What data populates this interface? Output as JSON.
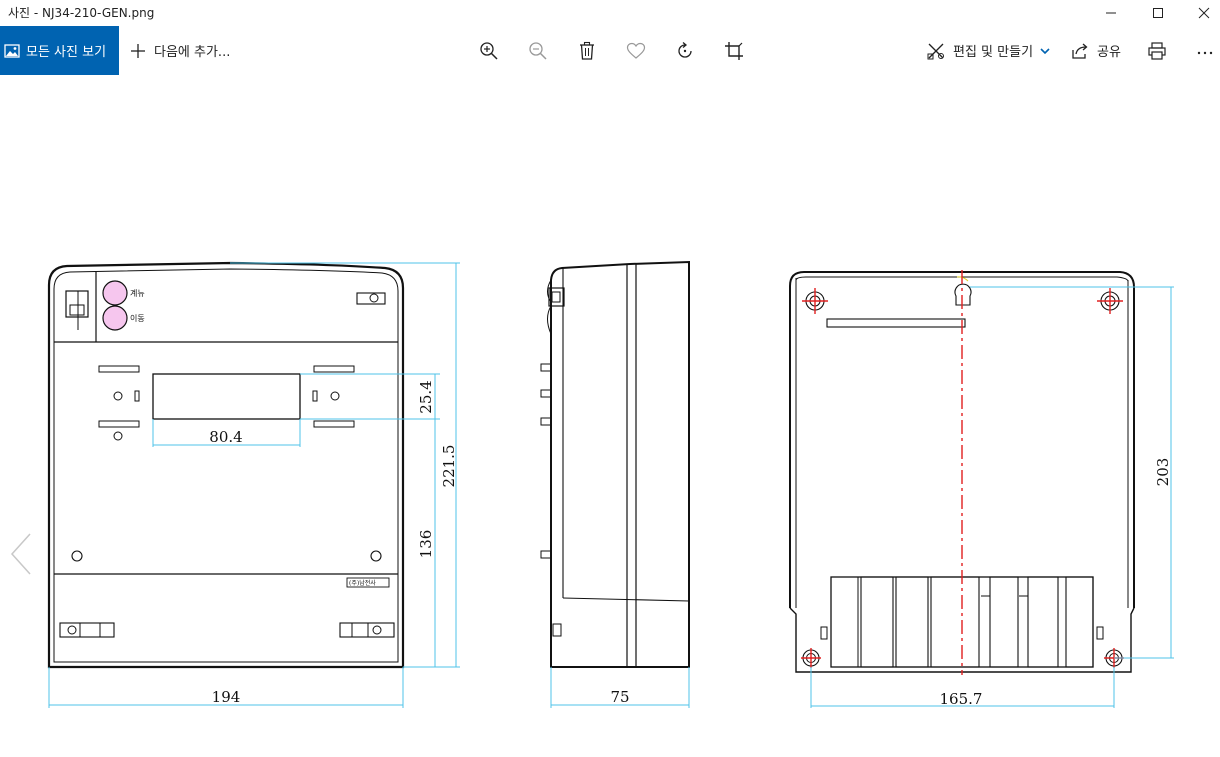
{
  "window": {
    "title": "사진 - NJ34-210-GEN.png"
  },
  "toolbar": {
    "all_photos_label": "모든 사진 보기",
    "add_to_label": "다음에 추가...",
    "edit_create_label": "편집 및 만들기",
    "share_label": "공유"
  },
  "drawing": {
    "front_button_top_label": "계뉴",
    "front_button_bottom_label": "이동",
    "nameplate_label": "(주)남전사",
    "dim_window_width": "80.4",
    "dim_window_height": "25.4",
    "dim_height_total": "221.5",
    "dim_height_lower": "136",
    "dim_front_width": "194",
    "dim_side_depth": "75",
    "dim_back_height": "203",
    "dim_back_width": "165.7"
  },
  "colors": {
    "accent": "#0063b1",
    "dimension_line": "#4fc3e8",
    "center_line": "#e02020",
    "outline": "#111111",
    "button_fill": "#f6c6ee"
  }
}
